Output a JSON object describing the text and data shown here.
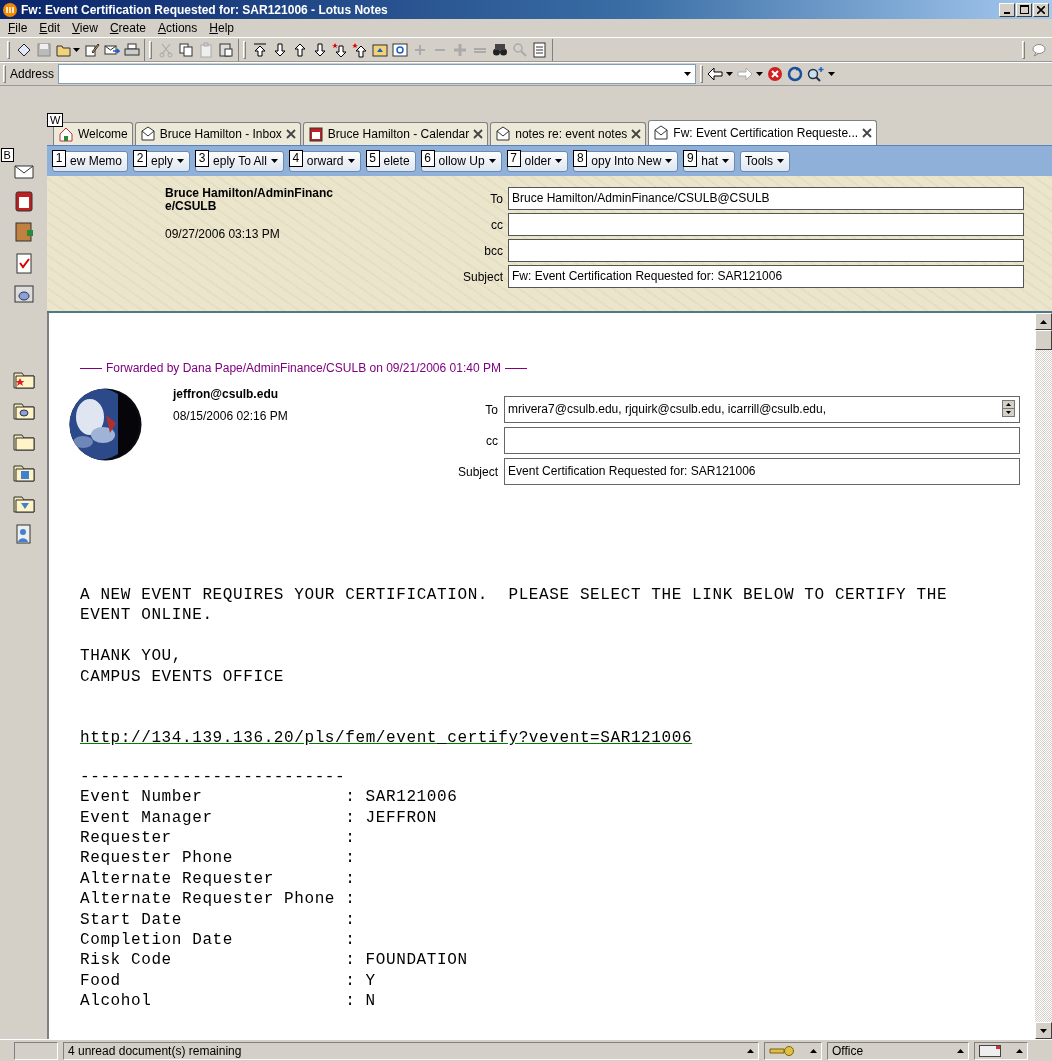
{
  "window": {
    "title": "Fw: Event Certification Requested for: SAR121006 - Lotus Notes"
  },
  "menu": [
    "File",
    "Edit",
    "View",
    "Create",
    "Actions",
    "Help"
  ],
  "address": {
    "label": "Address"
  },
  "sidebar": {
    "hint": "B"
  },
  "tabs": [
    {
      "label": "Welcome",
      "hint": "W",
      "closable": false,
      "selected": false
    },
    {
      "label": "Bruce Hamilton - Inbox",
      "closable": true,
      "selected": false
    },
    {
      "label": "Bruce Hamilton - Calendar",
      "closable": true,
      "selected": false
    },
    {
      "label": "notes re: event notes",
      "closable": true,
      "selected": false
    },
    {
      "label": "Fw: Event Certification Requeste...",
      "closable": true,
      "selected": true
    }
  ],
  "actions": [
    {
      "key": "1",
      "label": "ew Memo",
      "dropdown": false
    },
    {
      "key": "2",
      "label": "eply",
      "dropdown": true
    },
    {
      "key": "3",
      "label": "eply To All",
      "dropdown": true
    },
    {
      "key": "4",
      "label": "orward",
      "dropdown": true
    },
    {
      "key": "5",
      "label": "elete",
      "dropdown": false
    },
    {
      "key": "6",
      "label": "ollow Up",
      "dropdown": true
    },
    {
      "key": "7",
      "label": "older",
      "dropdown": true
    },
    {
      "key": "8",
      "label": "opy Into New",
      "dropdown": true
    },
    {
      "key": "9",
      "label": "hat",
      "dropdown": true
    },
    {
      "label": "Tools",
      "dropdown": true
    }
  ],
  "header": {
    "sender": "Bruce Hamilton/AdminFinance/CSULB",
    "date": "09/27/2006 03:13 PM",
    "fields": [
      {
        "label": "To",
        "value": "Bruce Hamilton/AdminFinance/CSULB@CSULB"
      },
      {
        "label": "cc"
      },
      {
        "label": "bcc"
      },
      {
        "label": "Subject",
        "value": "Fw: Event Certification Requested for: SAR121006"
      }
    ]
  },
  "forwarded": {
    "text": "Forwarded by Dana Pape/AdminFinance/CSULB on 09/21/2006 01:40 PM"
  },
  "original": {
    "sender": "jeffron@csulb.edu",
    "date": "08/15/2006 02:16 PM",
    "fields": [
      {
        "label": "To",
        "value": "mrivera7@csulb.edu, rjquirk@csulb.edu, icarrill@csulb.edu,",
        "spinner": true
      },
      {
        "label": "cc"
      },
      {
        "label": "Subject",
        "value": "Event Certification Requested for: SAR121006"
      }
    ]
  },
  "message": {
    "paragraphs": [
      [
        "A NEW EVENT REQUIRES YOUR CERTIFICATION.  PLEASE SELECT THE LINK BELOW TO CERTIFY THE",
        "EVENT ONLINE."
      ],
      [
        "THANK YOU,",
        "CAMPUS EVENTS OFFICE"
      ]
    ],
    "link": "http://134.139.136.20/pls/fem/event_certify?vevent=SAR121006",
    "rule": "--------------------------",
    "details": [
      {
        "label": "Event Number",
        "value": ": SAR121006"
      },
      {
        "label": "Event Manager",
        "value": ": JEFFRON"
      },
      {
        "label": "Requester",
        "value": ":"
      },
      {
        "label": "Requester Phone",
        "value": ":"
      },
      {
        "label": "Alternate Requester",
        "value": ":"
      },
      {
        "label": "Alternate Requester Phone",
        "value": ":"
      },
      {
        "label": "Start Date",
        "value": ":"
      },
      {
        "label": "Completion Date",
        "value": ":"
      },
      {
        "label": "Risk Code",
        "value": ": FOUNDATION"
      },
      {
        "label": "Food",
        "value": ": Y"
      },
      {
        "label": "Alcohol",
        "value": ": N"
      }
    ]
  },
  "status_bar": {
    "message": "4 unread document(s) remaining",
    "location": "Office"
  }
}
